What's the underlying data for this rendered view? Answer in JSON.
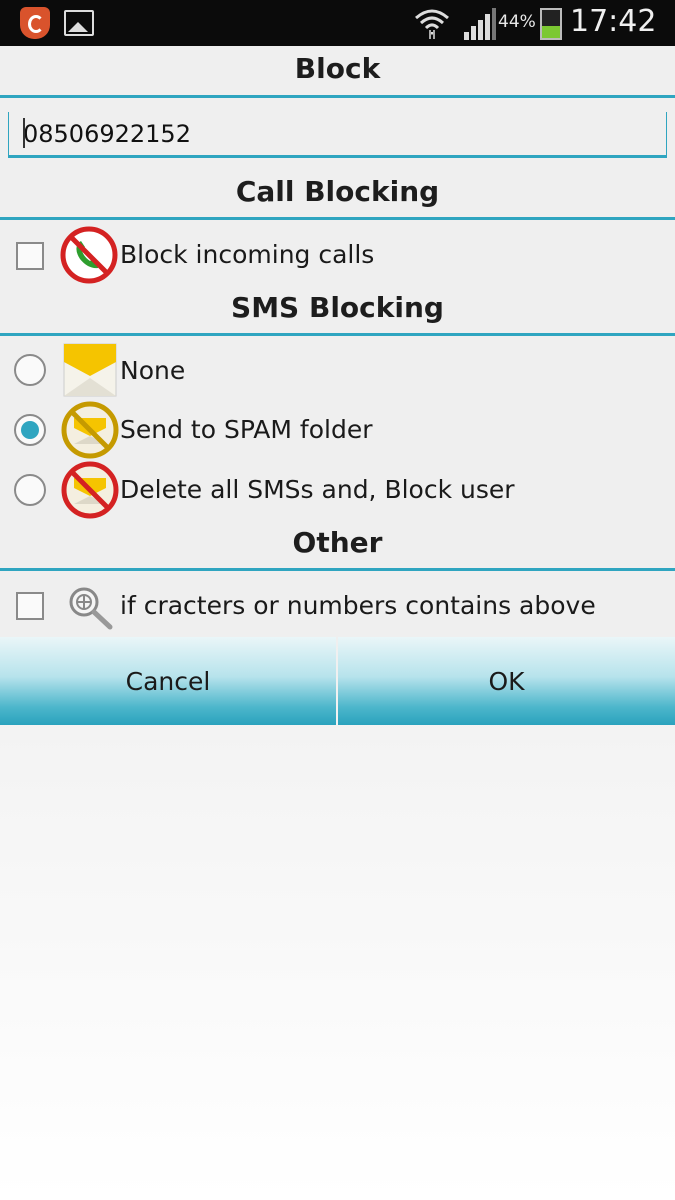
{
  "status_bar": {
    "battery_percent": "44%",
    "battery_level": 0.44,
    "time": "17:42",
    "icons": [
      "app-shield-icon",
      "gallery-icon",
      "wifi-icon",
      "signal-icon",
      "battery-icon"
    ]
  },
  "dialog": {
    "title": "Block",
    "phone_number": "08506922152",
    "call_section_title": "Call Blocking",
    "block_calls_label": "Block incoming calls",
    "block_calls_checked": false,
    "sms_section_title": "SMS Blocking",
    "sms_options": [
      {
        "label": "None",
        "selected": false,
        "icon": "envelope-icon"
      },
      {
        "label": "Send to SPAM folder",
        "selected": true,
        "icon": "envelope-spam-icon"
      },
      {
        "label": "Delete all SMSs and, Block user",
        "selected": false,
        "icon": "envelope-blocked-icon"
      }
    ],
    "other_section_title": "Other",
    "contains_label": "if cracters or numbers contains above",
    "contains_checked": false,
    "cancel_label": "Cancel",
    "ok_label": "OK"
  },
  "colors": {
    "accent": "#2fa5c0",
    "status_bar_bg": "#0b0b0b",
    "button_gradient_bottom": "#2aa2bd"
  }
}
